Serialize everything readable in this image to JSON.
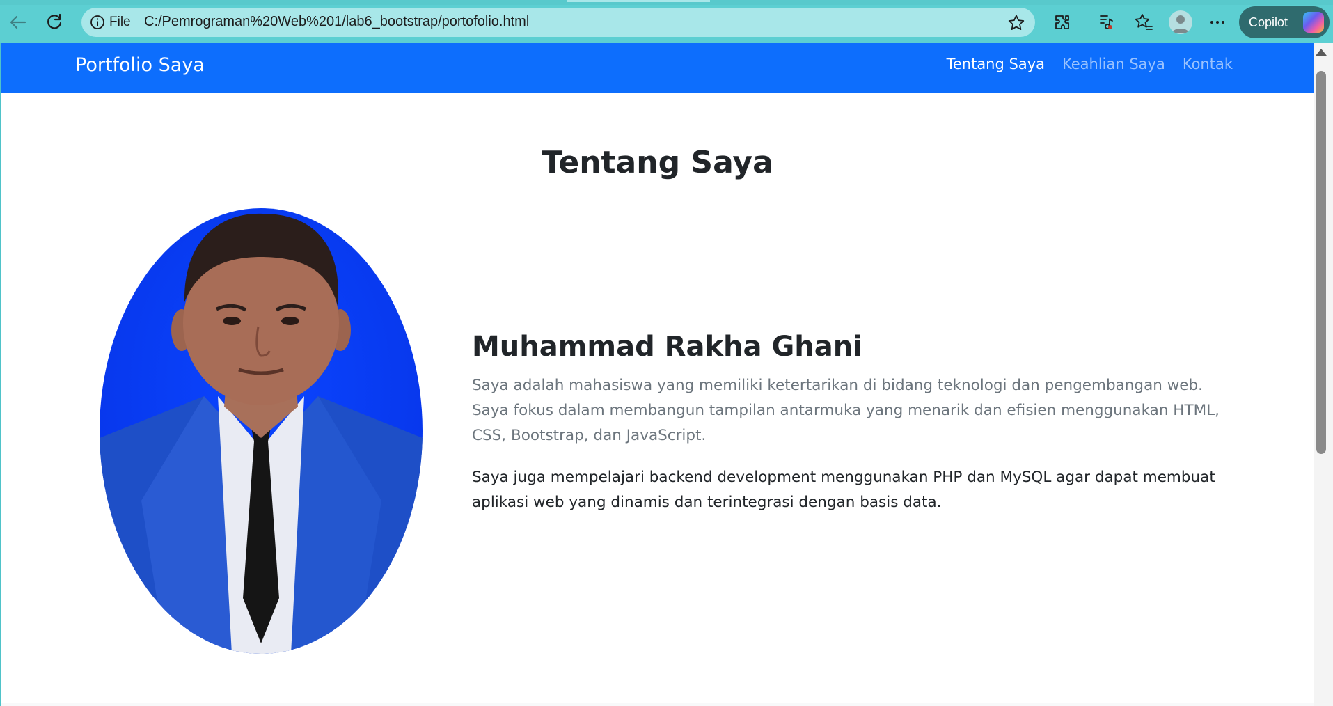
{
  "browser": {
    "scheme": "File",
    "url": "C:/Pemrograman%20Web%201/lab6_bootstrap/portofolio.html",
    "copilot_label": "Copilot",
    "icons": [
      "back-arrow-icon",
      "reload-icon",
      "info-icon",
      "star-icon",
      "extensions-icon",
      "media-icon",
      "favorites-icon",
      "profile-icon",
      "more-icon",
      "copilot-icon"
    ]
  },
  "navbar": {
    "brand": "Portfolio Saya",
    "links": [
      {
        "label": "Tentang Saya",
        "active": true
      },
      {
        "label": "Keahlian Saya",
        "active": false
      },
      {
        "label": "Kontak",
        "active": false
      }
    ],
    "color": "#0d6efd"
  },
  "about": {
    "title": "Tentang Saya",
    "name": "Muhammad Rakha Ghani",
    "lead": "Saya adalah mahasiswa yang memiliki ketertarikan di bidang teknologi dan pengembangan web. Saya fokus dalam membangun tampilan antarmuka yang menarik dan efisien menggunakan HTML, CSS, Bootstrap, dan JavaScript.",
    "paragraph": "Saya juga mempelajari backend development menggunakan PHP dan MySQL agar dapat membuat aplikasi web yang dinamis dan terintegrasi dengan basis data."
  },
  "colors": {
    "chrome": "#5ccfd2",
    "address_bar": "#a8e7e9",
    "photo_background": "#0a3cf5",
    "suit": "#1f4fc4"
  }
}
